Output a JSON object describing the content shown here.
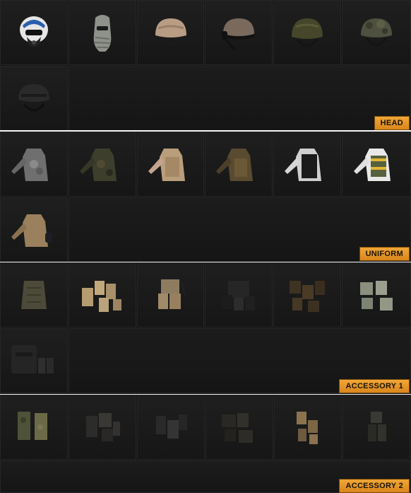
{
  "sections": [
    {
      "label": "HEAD",
      "items": [
        {
          "name": "pilot-helmet-icon"
        },
        {
          "name": "shemagh-balaclava-icon"
        },
        {
          "name": "tan-combat-helmet-icon"
        },
        {
          "name": "headset-helmet-icon"
        },
        {
          "name": "olive-combat-helmet-icon"
        },
        {
          "name": "camo-combat-helmet-icon"
        },
        {
          "name": "black-tactical-helmet-icon"
        }
      ]
    },
    {
      "label": "UNIFORM",
      "items": [
        {
          "name": "urban-camo-jacket-icon"
        },
        {
          "name": "woodland-camo-jacket-icon"
        },
        {
          "name": "tan-vest-shirt-icon"
        },
        {
          "name": "olive-combat-jacket-icon"
        },
        {
          "name": "black-vest-shirt-icon"
        },
        {
          "name": "white-hivis-vest-icon"
        },
        {
          "name": "tan-combat-jacket-icon"
        }
      ]
    },
    {
      "label": "ACCESSORY 1",
      "items": [
        {
          "name": "plate-carrier-icon"
        },
        {
          "name": "tan-pouch-set-icon"
        },
        {
          "name": "chest-rig-icon"
        },
        {
          "name": "black-load-bearing-vest-icon"
        },
        {
          "name": "brown-ammo-pouches-icon"
        },
        {
          "name": "grey-pouch-set-icon"
        },
        {
          "name": "black-tactical-vest-icon"
        }
      ]
    },
    {
      "label": "ACCESSORY 2",
      "items": [
        {
          "name": "camo-leg-holster-icon"
        },
        {
          "name": "black-holster-set-icon"
        },
        {
          "name": "black-drop-leg-holster-icon"
        },
        {
          "name": "black-leg-pouches-icon"
        },
        {
          "name": "tan-leg-pouches-icon"
        },
        {
          "name": "black-utility-pouch-icon"
        }
      ]
    }
  ],
  "colors": {
    "label_bg": "#e89a2a",
    "cell_bg": "#1c1c1c"
  }
}
